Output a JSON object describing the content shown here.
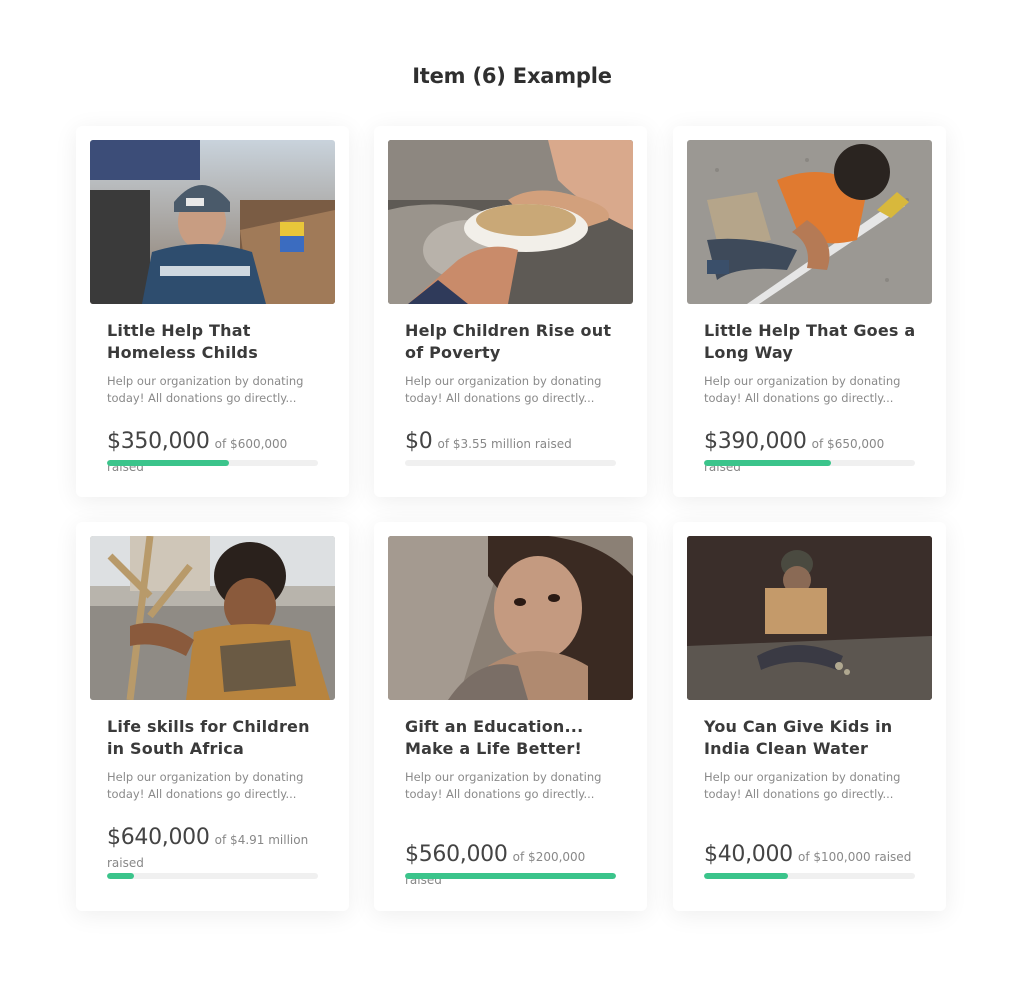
{
  "page": {
    "title": "Item (6) Example"
  },
  "colors": {
    "accent": "#3bc48b",
    "track": "#f0f0f0"
  },
  "cards": [
    {
      "title": "Little Help That Homeless Childs",
      "description": "Help our organization by donating today! All donations go directly...",
      "amount": "$350,000",
      "goal_text": "of $600,000 raised",
      "progress": 0.58
    },
    {
      "title": "Help Children Rise out of Poverty",
      "description": "Help our organization by donating today! All donations go directly...",
      "amount": "$0",
      "goal_text": "of $3.55 million raised",
      "progress": 0
    },
    {
      "title": "Little Help That Goes a Long Way",
      "description": "Help our organization by donating today! All donations go directly...",
      "amount": "$390,000",
      "goal_text": "of $650,000 raised",
      "progress": 0.6
    },
    {
      "title": "Life skills for Children in South Africa",
      "description": "Help our organization by donating today! All donations go directly...",
      "amount": "$640,000",
      "goal_text": "of $4.91 million raised",
      "progress": 0.13
    },
    {
      "title": "Gift an Education... Make a Life Better!",
      "description": "Help our organization by donating today! All donations go directly...",
      "amount": "$560,000",
      "goal_text": "of $200,000 raised",
      "progress": 1.0
    },
    {
      "title": "You Can Give Kids in India Clean Water",
      "description": "Help our organization by donating today! All donations go directly...",
      "amount": "$40,000",
      "goal_text": "of $100,000 raised",
      "progress": 0.4
    }
  ]
}
